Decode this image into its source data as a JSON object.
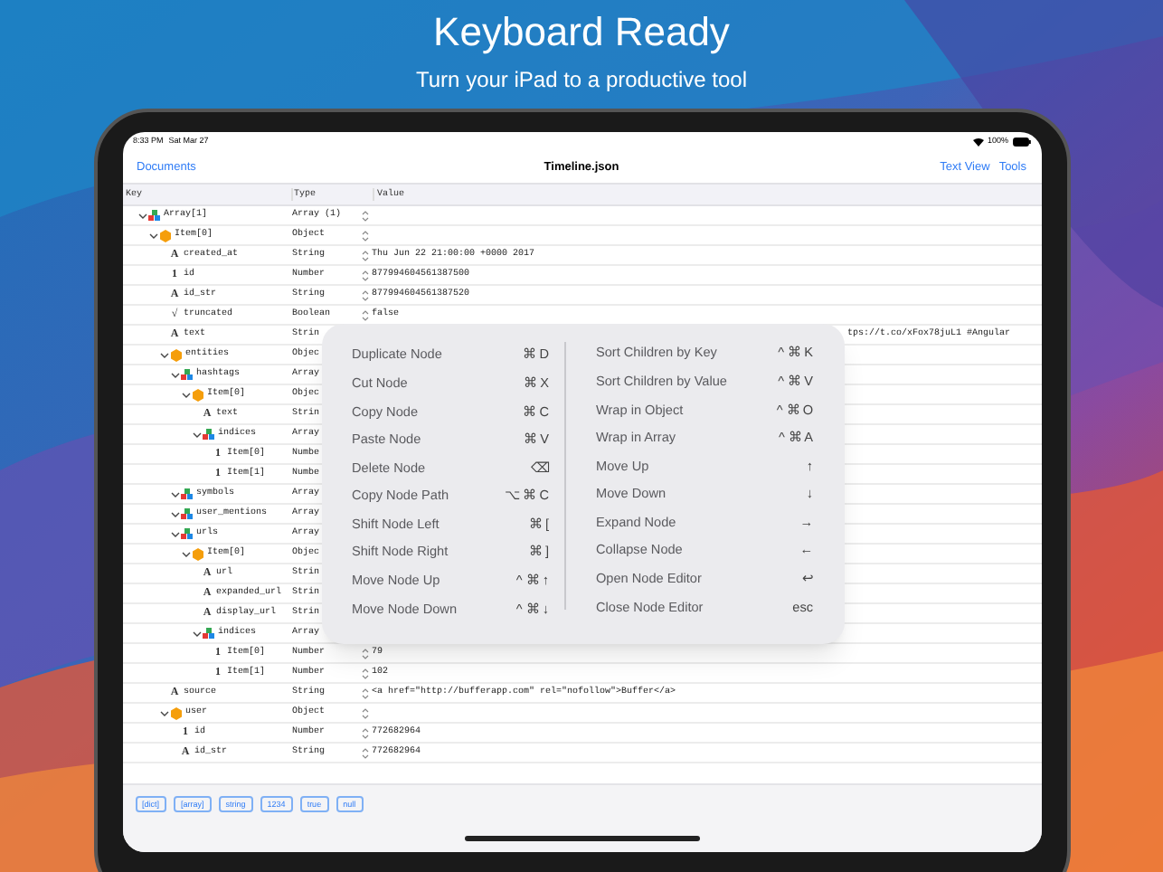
{
  "headline": "Keyboard Ready",
  "subheadline": "Turn your iPad to a productive tool",
  "status_bar": {
    "time": "8:33 PM",
    "date": "Sat Mar 27",
    "battery": "100%"
  },
  "nav": {
    "back": "Documents",
    "title": "Timeline.json",
    "actions": [
      "Text View",
      "Tools"
    ]
  },
  "table": {
    "columns": [
      "Key",
      "Type",
      "Value"
    ],
    "rows": [
      {
        "key": "Array[1]",
        "kind": "array",
        "type": "Array (1)",
        "expanded": true,
        "children": [
          {
            "key": "Item[0]",
            "kind": "object",
            "type": "Object",
            "expanded": true,
            "children": [
              {
                "key": "created_at",
                "kind": "string",
                "glyph": "A",
                "type": "String",
                "value": "Thu Jun 22 21:00:00 +0000 2017"
              },
              {
                "key": "id",
                "kind": "number",
                "glyph": "1",
                "type": "Number",
                "value": "877994604561387500"
              },
              {
                "key": "id_str",
                "kind": "string",
                "glyph": "A",
                "type": "String",
                "value": "877994604561387520"
              },
              {
                "key": "truncated",
                "kind": "boolean",
                "glyph": "√",
                "type": "Boolean",
                "value": "false"
              },
              {
                "key": "text",
                "kind": "string",
                "glyph": "A",
                "type": "Strin",
                "value": "tps://t.co/xFox78juL1 #Angular",
                "covered": true
              },
              {
                "key": "entities",
                "kind": "object",
                "type": "Objec",
                "expanded": true,
                "children": [
                  {
                    "key": "hashtags",
                    "kind": "array",
                    "type": "Array",
                    "expanded": true,
                    "children": [
                      {
                        "key": "Item[0]",
                        "kind": "object",
                        "type": "Objec",
                        "expanded": true,
                        "children": [
                          {
                            "key": "text",
                            "kind": "string",
                            "glyph": "A",
                            "type": "Strin"
                          },
                          {
                            "key": "indices",
                            "kind": "array",
                            "type": "Array",
                            "expanded": true,
                            "children": [
                              {
                                "key": "Item[0]",
                                "kind": "number",
                                "glyph": "1",
                                "type": "Numbe"
                              },
                              {
                                "key": "Item[1]",
                                "kind": "number",
                                "glyph": "1",
                                "type": "Numbe"
                              }
                            ]
                          }
                        ]
                      }
                    ]
                  },
                  {
                    "key": "symbols",
                    "kind": "array",
                    "type": "Array",
                    "expanded": true
                  },
                  {
                    "key": "user_mentions",
                    "kind": "array",
                    "type": "Array",
                    "expanded": true
                  },
                  {
                    "key": "urls",
                    "kind": "array",
                    "type": "Array",
                    "expanded": true,
                    "children": [
                      {
                        "key": "Item[0]",
                        "kind": "object",
                        "type": "Objec",
                        "expanded": true,
                        "children": [
                          {
                            "key": "url",
                            "kind": "string",
                            "glyph": "A",
                            "type": "Strin"
                          },
                          {
                            "key": "expanded_url",
                            "kind": "string",
                            "glyph": "A",
                            "type": "Strin"
                          },
                          {
                            "key": "display_url",
                            "kind": "string",
                            "glyph": "A",
                            "type": "Strin"
                          },
                          {
                            "key": "indices",
                            "kind": "array",
                            "type": "Array",
                            "expanded": true,
                            "children": [
                              {
                                "key": "Item[0]",
                                "kind": "number",
                                "glyph": "1",
                                "type": "Number",
                                "value": "79"
                              },
                              {
                                "key": "Item[1]",
                                "kind": "number",
                                "glyph": "1",
                                "type": "Number",
                                "value": "102"
                              }
                            ]
                          }
                        ]
                      }
                    ]
                  }
                ]
              },
              {
                "key": "source",
                "kind": "string",
                "glyph": "A",
                "type": "String",
                "value": "<a href=\"http://bufferapp.com\" rel=\"nofollow\">Buffer</a>"
              },
              {
                "key": "user",
                "kind": "object",
                "type": "Object",
                "expanded": true,
                "children": [
                  {
                    "key": "id",
                    "kind": "number",
                    "glyph": "1",
                    "type": "Number",
                    "value": "772682964"
                  },
                  {
                    "key": "id_str",
                    "kind": "string",
                    "glyph": "A",
                    "type": "String",
                    "value": "772682964"
                  }
                ]
              }
            ]
          }
        ]
      }
    ]
  },
  "toolbar": [
    "[dict]",
    "[array]",
    "string",
    "1234",
    "true",
    "null"
  ],
  "shortcuts": {
    "columns": [
      [
        {
          "label": "Duplicate Node",
          "keys": "⌘ D"
        },
        {
          "label": "Cut Node",
          "keys": "⌘ X"
        },
        {
          "label": "Copy Node",
          "keys": "⌘ C"
        },
        {
          "label": "Paste Node",
          "keys": "⌘ V"
        },
        {
          "label": "Delete Node",
          "keys": "⌫"
        },
        {
          "label": "Copy Node Path",
          "keys": "⌥ ⌘ C"
        },
        {
          "label": "Shift Node Left",
          "keys": "⌘ ["
        },
        {
          "label": "Shift Node Right",
          "keys": "⌘ ]"
        },
        {
          "label": "Move Node Up",
          "keys": "^ ⌘ ↑"
        },
        {
          "label": "Move Node Down",
          "keys": "^ ⌘ ↓"
        }
      ],
      [
        {
          "label": "Sort Children by Key",
          "keys": "^ ⌘ K"
        },
        {
          "label": "Sort Children by Value",
          "keys": "^ ⌘ V"
        },
        {
          "label": "Wrap in Object",
          "keys": "^ ⌘ O"
        },
        {
          "label": "Wrap in Array",
          "keys": "^ ⌘ A"
        },
        {
          "label": "Move Up",
          "keys": "↑"
        },
        {
          "label": "Move Down",
          "keys": "↓"
        },
        {
          "label": "Expand Node",
          "keys": "→"
        },
        {
          "label": "Collapse Node",
          "keys": "←"
        },
        {
          "label": "Open Node Editor",
          "keys": "↩"
        },
        {
          "label": "Close Node Editor",
          "keys": "esc"
        }
      ]
    ]
  }
}
